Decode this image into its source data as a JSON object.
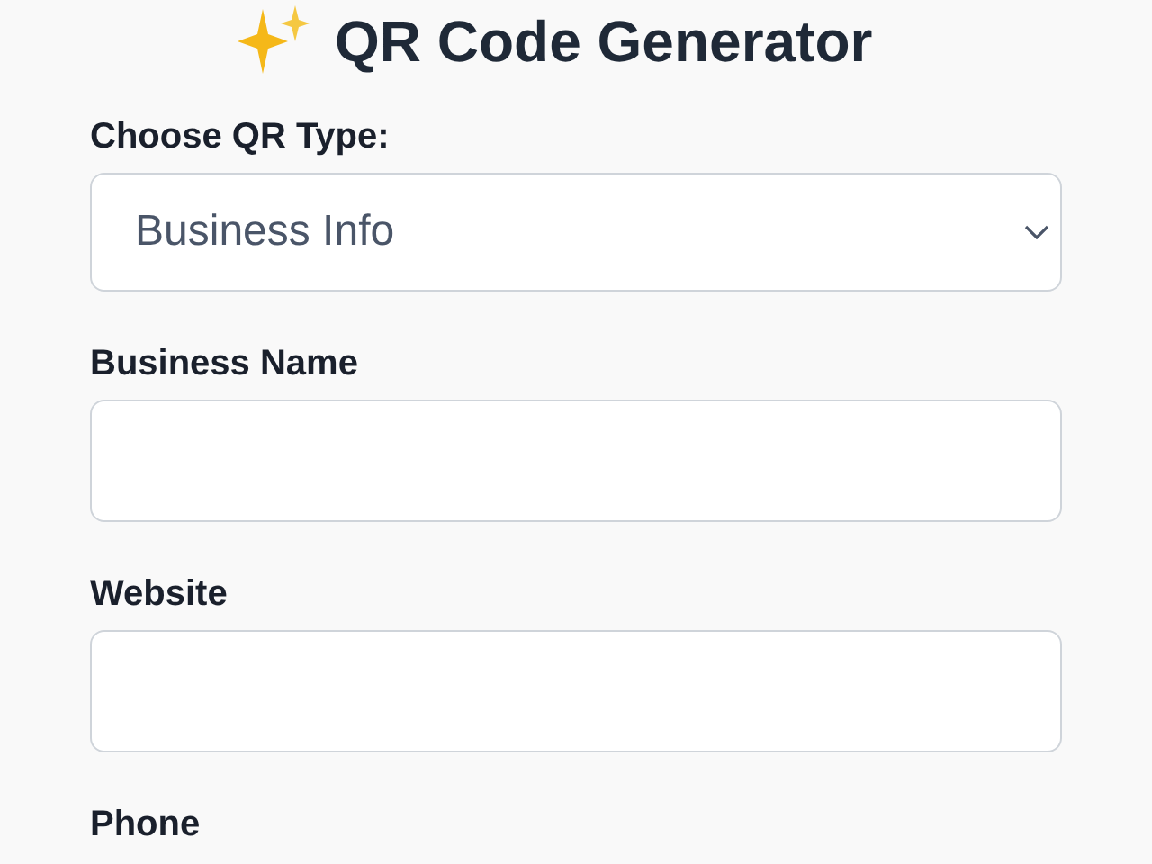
{
  "title": "QR Code Generator",
  "qr_type": {
    "label": "Choose QR Type:",
    "value": "Business Info"
  },
  "fields": [
    {
      "label": "Business Name"
    },
    {
      "label": "Website"
    },
    {
      "label": "Phone"
    }
  ]
}
